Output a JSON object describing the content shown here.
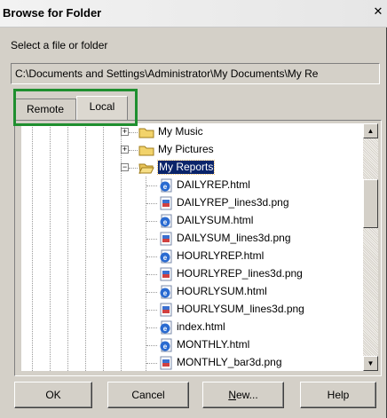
{
  "window": {
    "title": "Browse for Folder",
    "close_symbol": "✕"
  },
  "prompt": "Select a file or folder",
  "path_value": "C:\\Documents and Settings\\Administrator\\My Documents\\My Re",
  "tabs": [
    {
      "label": "Remote",
      "selected": false
    },
    {
      "label": "Local",
      "selected": true
    }
  ],
  "tree": {
    "folders": [
      {
        "label": "My Music",
        "expander": "+",
        "icon": "folder-closed-icon"
      },
      {
        "label": "My Pictures",
        "expander": "+",
        "icon": "folder-closed-icon"
      },
      {
        "label": "My Reports",
        "expander": "−",
        "icon": "folder-open-icon",
        "selected": true
      }
    ],
    "files": [
      {
        "label": "DAILYREP.html",
        "icon": "html-file-icon"
      },
      {
        "label": "DAILYREP_lines3d.png",
        "icon": "png-file-icon"
      },
      {
        "label": "DAILYSUM.html",
        "icon": "html-file-icon"
      },
      {
        "label": "DAILYSUM_lines3d.png",
        "icon": "png-file-icon"
      },
      {
        "label": "HOURLYREP.html",
        "icon": "html-file-icon"
      },
      {
        "label": "HOURLYREP_lines3d.png",
        "icon": "png-file-icon"
      },
      {
        "label": "HOURLYSUM.html",
        "icon": "html-file-icon"
      },
      {
        "label": "HOURLYSUM_lines3d.png",
        "icon": "png-file-icon"
      },
      {
        "label": "index.html",
        "icon": "html-file-icon"
      },
      {
        "label": "MONTHLY.html",
        "icon": "html-file-icon"
      },
      {
        "label": "MONTHLY_bar3d.png",
        "icon": "png-file-icon"
      }
    ]
  },
  "buttons": {
    "ok": "OK",
    "cancel": "Cancel",
    "new_mnemonic": "N",
    "new_rest": "ew...",
    "help": "Help"
  },
  "colors": {
    "dialog_bg": "#d4d0c8",
    "selection_bg": "#0a246a",
    "highlight_border": "#1f8f2f",
    "folder_yellow": "#f2d36b",
    "html_icon_blue": "#2a6bd1"
  }
}
